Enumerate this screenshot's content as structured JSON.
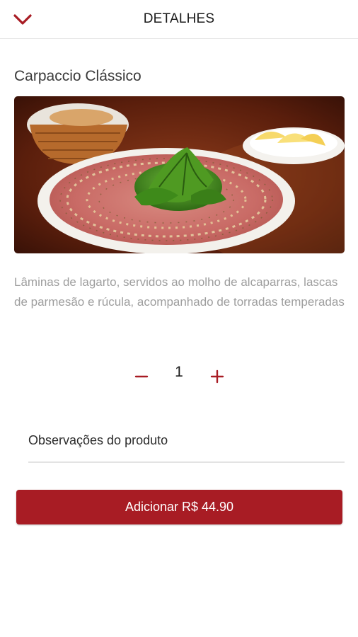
{
  "header": {
    "title": "DETALHES",
    "back_icon": "chevron-down-icon"
  },
  "product": {
    "name": "Carpaccio Clássico",
    "image_icon": "carpaccio-photo",
    "description": "Lâminas de lagarto, servidos ao molho de alcaparras, lascas de parmesão e rúcula, acompanhado de torradas temperadas"
  },
  "quantity": {
    "value": "1",
    "minus_icon": "minus-icon",
    "plus_icon": "plus-icon"
  },
  "observations": {
    "placeholder": "Observações do produto",
    "value": ""
  },
  "add_button": {
    "label": "Adicionar R$ 44.90"
  },
  "colors": {
    "accent": "#a81c24",
    "description_text": "#9e9e9e"
  }
}
